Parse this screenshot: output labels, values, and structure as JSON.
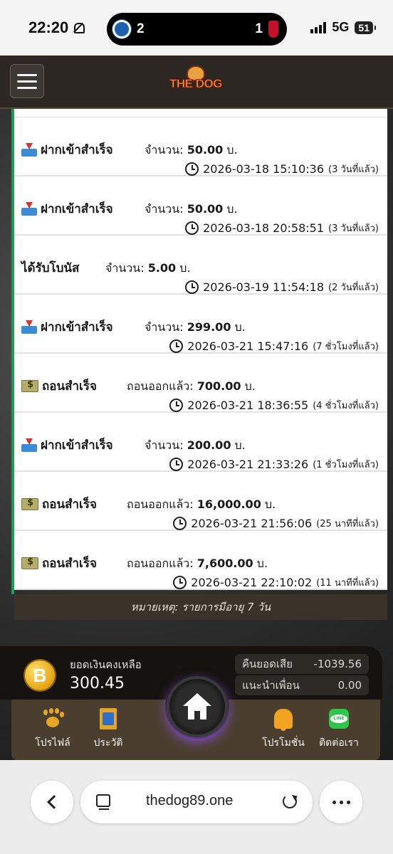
{
  "status_bar": {
    "time": "22:20",
    "score_left": "2",
    "score_right": "1",
    "network": "5G",
    "battery": "51"
  },
  "header": {
    "logo_text": "THE DOG"
  },
  "transactions": [
    {
      "type": "deposit",
      "title": "ฝากเข้าสำเร็จ",
      "amount_label": "จำนวน:",
      "amount": "50.00",
      "unit": "บ.",
      "datetime": "2026-03-18 15:10:36",
      "ago": "(3 วันที่แล้ว)"
    },
    {
      "type": "deposit",
      "title": "ฝากเข้าสำเร็จ",
      "amount_label": "จำนวน:",
      "amount": "50.00",
      "unit": "บ.",
      "datetime": "2026-03-18 20:58:51",
      "ago": "(3 วันที่แล้ว)"
    },
    {
      "type": "bonus",
      "title": "ได้รับโบนัส",
      "amount_label": "จำนวน:",
      "amount": "5.00",
      "unit": "บ.",
      "datetime": "2026-03-19 11:54:18",
      "ago": "(2 วันที่แล้ว)"
    },
    {
      "type": "deposit",
      "title": "ฝากเข้าสำเร็จ",
      "amount_label": "จำนวน:",
      "amount": "299.00",
      "unit": "บ.",
      "datetime": "2026-03-21 15:47:16",
      "ago": "(7 ชั่วโมงที่แล้ว)"
    },
    {
      "type": "withdraw",
      "title": "ถอนสำเร็จ",
      "amount_label": "ถอนออกแล้ว:",
      "amount": "700.00",
      "unit": "บ.",
      "datetime": "2026-03-21 18:36:55",
      "ago": "(4 ชั่วโมงที่แล้ว)"
    },
    {
      "type": "deposit",
      "title": "ฝากเข้าสำเร็จ",
      "amount_label": "จำนวน:",
      "amount": "200.00",
      "unit": "บ.",
      "datetime": "2026-03-21 21:33:26",
      "ago": "(1 ชั่วโมงที่แล้ว)"
    },
    {
      "type": "withdraw",
      "title": "ถอนสำเร็จ",
      "amount_label": "ถอนออกแล้ว:",
      "amount": "16,000.00",
      "unit": "บ.",
      "datetime": "2026-03-21 21:56:06",
      "ago": "(25 นาทีที่แล้ว)"
    },
    {
      "type": "withdraw",
      "title": "ถอนสำเร็จ",
      "amount_label": "ถอนออกแล้ว:",
      "amount": "7,600.00",
      "unit": "บ.",
      "datetime": "2026-03-21 22:10:02",
      "ago": "(11 นาทีที่แล้ว)"
    }
  ],
  "note": "หมายเหตุ: รายการมีอายุ 7 วัน",
  "wallet": {
    "balance_label": "ยอดเงินคงเหลือ",
    "balance": "300.45",
    "cashback_label": "คืนยอดเสีย",
    "cashback_value": "-1039.56",
    "referral_label": "แนะนำเพื่อน",
    "referral_value": "0.00"
  },
  "nav": {
    "profile": "โปรไฟล์",
    "history": "ประวัติ",
    "promotion": "โปรโมชั่น",
    "contact": "ติดต่อเรา"
  },
  "browser": {
    "url": "thedog89.one"
  }
}
